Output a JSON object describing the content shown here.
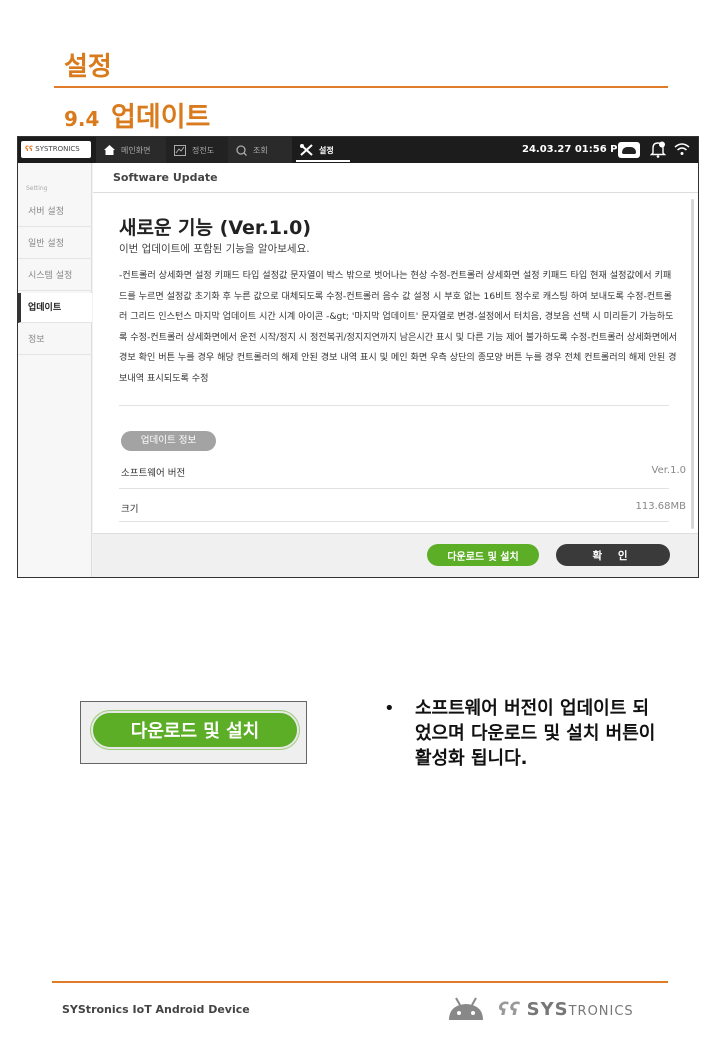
{
  "page": {
    "heading": "설정",
    "section_number": "9.4",
    "section_title": "업데이트"
  },
  "device": {
    "logo_mark": "ʕʕ",
    "logo_text": "SYSTRONICS",
    "nav_tabs": [
      "메인화면",
      "정전도",
      "조회",
      "설정"
    ],
    "datetime": "24.03.27 01:56 PM",
    "sidebar": {
      "caption": "Setting",
      "items": [
        "서버 설정",
        "일반 설정",
        "시스템 설정",
        "업데이트",
        "정보"
      ],
      "active": "업데이트"
    },
    "content": {
      "header": "Software Update",
      "feature_title": "새로운 기능 (Ver.1.0)",
      "feature_subtitle": "이번 업데이트에 포함된 기능을 알아보세요.",
      "changelog": "-컨트롤러 상세화면 설정 키패드 타입 설정값 문자열이 박스 밖으로 벗어나는 현상 수정-컨트롤러 상세화면 설정 키패드 타입 현재 설정값에서 키패드를 누르면 설정값 초기화 후 누른 값으로 대체되도록 수정-컨트롤러 음수 값 설정 시 부호 없는 16비트 정수로 캐스팅 하여 보내도록 수정-컨트롤러 그리드 인스턴스 마지막 업데이트 시간 시계 아이콘 -&gt; '마지막 업데이트' 문자열로 변경-설정에서 터치음, 경보음 선택 시 미리듣기 가능하도록 수정-컨트롤러 상세화면에서 운전 시작/정지 시 정전복귀/정지지연까지 남은시간 표시 및 다른 기능 제어 불가하도록 수정-컨트롤러 상세화면에서 경보 확인 버튼 누를 경우 해당 컨트롤러의 해제 안된 경보 내역 표시 및 메인 화면 우측 상단의 종모양 버튼 누를 경우 전체 컨트롤러의 해제 안된 경보내역 표시되도록 수정",
      "info_pill": "업데이트 정보",
      "software_version_label": "소프트웨어 버전",
      "software_version_value": "Ver.1.0",
      "size_label": "크기",
      "size_value": "113.68MB",
      "download_button": "다운로드 및 설치",
      "confirm_button": "확 인"
    }
  },
  "zoom_button_label": "다운로드 및 설치",
  "note": {
    "bullet": "•",
    "text": "소프트웨어 버전이 업데이트 되었으며 다운로드 및 설치 버튼이 활성화 됩니다."
  },
  "footer": {
    "left_text": "SYStronics IoT Android Device",
    "brand_mark": "ʕʕ",
    "brand_text_big": "SYS",
    "brand_text_small": "TRONICS"
  },
  "colors": {
    "accent_orange": "#d97a1c",
    "button_green": "#5cae26",
    "button_dark": "#3a3a3a"
  }
}
